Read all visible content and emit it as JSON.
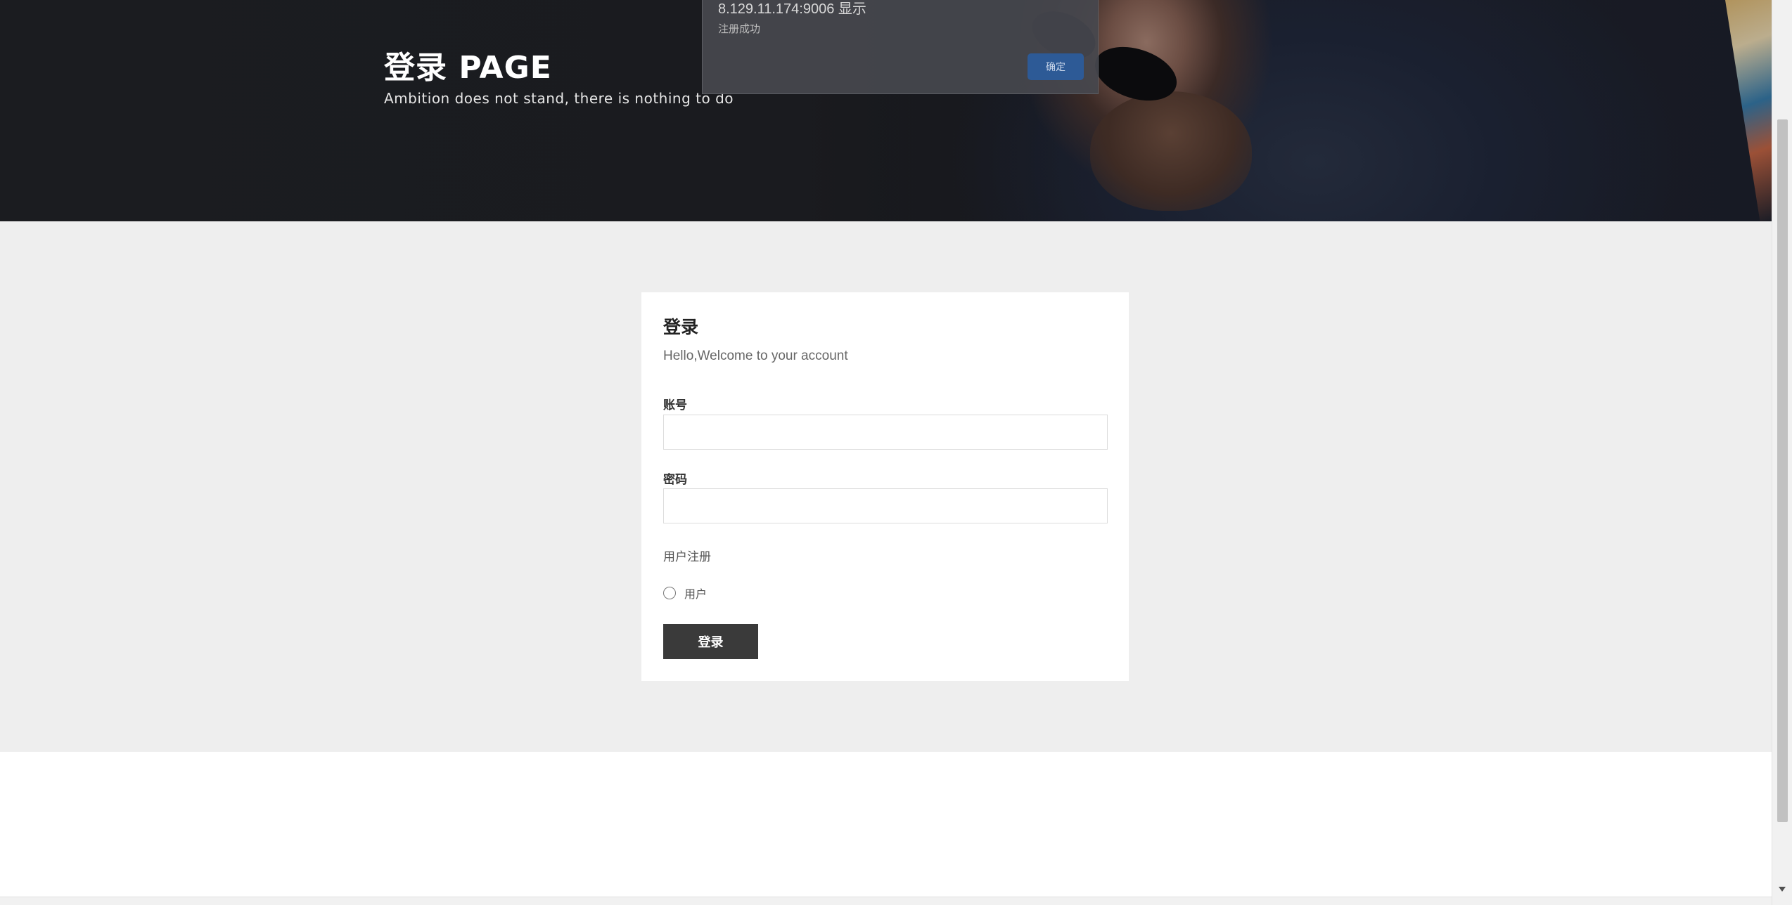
{
  "hero": {
    "title": "登录 PAGE",
    "subtitle": "Ambition does not stand, there is nothing to do"
  },
  "alert_dialog": {
    "origin": "8.129.11.174:9006 显示",
    "message": "注册成功",
    "ok_label": "确定"
  },
  "login_card": {
    "title": "登录",
    "subtitle": "Hello,Welcome to your account",
    "account_label": "账号",
    "account_value": "",
    "password_label": "密码",
    "password_value": "",
    "role_section_label": "用户注册",
    "role_option_label": "用户",
    "role_option_selected": false,
    "submit_label": "登录"
  },
  "colors": {
    "hero_bg": "#1b1c20",
    "page_bg": "#eeeeee",
    "card_bg": "#ffffff",
    "button_bg": "#3a3a3a",
    "dialog_button": "#2d5a96"
  }
}
